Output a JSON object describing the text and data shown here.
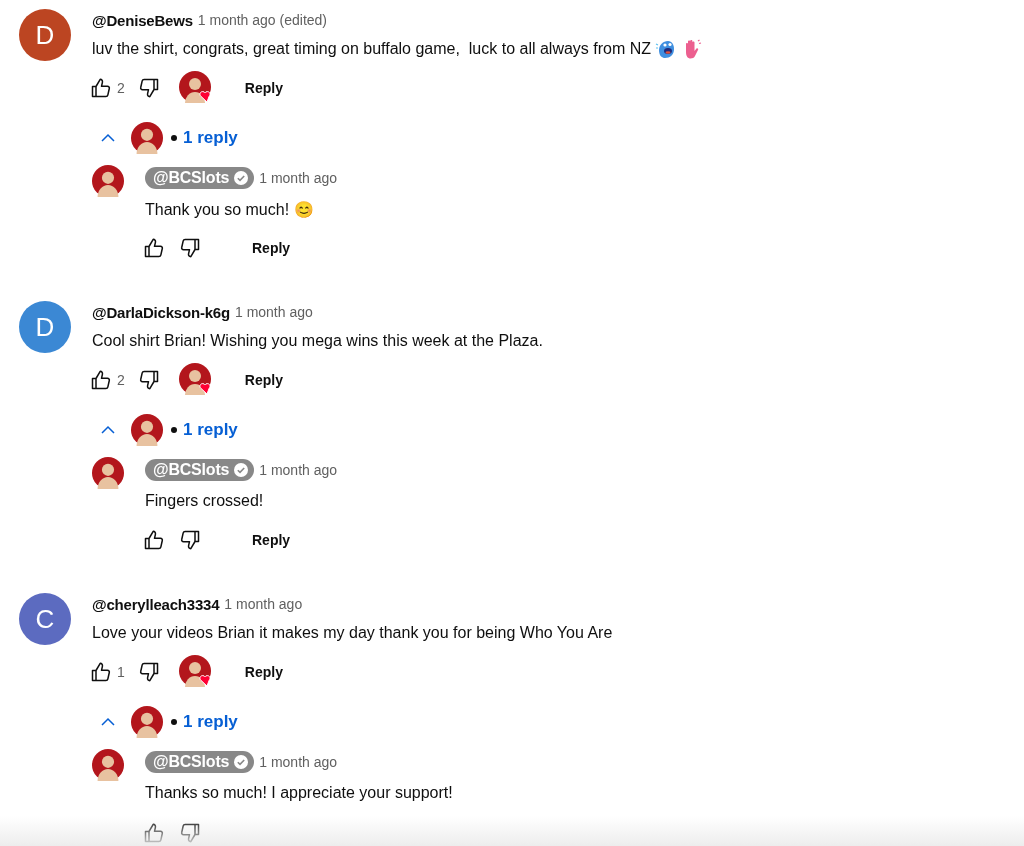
{
  "comments": [
    {
      "author": "@DeniseBews",
      "avatar_letter": "D",
      "color": "#bc4522",
      "time": "1 month ago (edited)",
      "text": "luv the shirt, congrats, great timing on buffalo game,  luck to all always from NZ",
      "emojis": [
        {
          "kind": "blob"
        },
        {
          "kind": "hand"
        }
      ],
      "likes": "2",
      "hearted": true,
      "reply_button": "Reply",
      "replies_toggle": {
        "expanded": true,
        "label": "1 reply"
      },
      "replies": [
        {
          "author": "@BCSlots",
          "creator": true,
          "verified": true,
          "time": "1 month ago",
          "text": "Thank you so much! 😊",
          "reply_button": "Reply",
          "actions_cut": false
        }
      ]
    },
    {
      "author": "@DarlaDickson-k6g",
      "avatar_letter": "D",
      "color": "#3b88d4",
      "time": "1 month ago",
      "text": "Cool shirt Brian! Wishing you mega wins this week at the Plaza.",
      "likes": "2",
      "hearted": true,
      "reply_button": "Reply",
      "replies_toggle": {
        "expanded": true,
        "label": "1 reply"
      },
      "replies": [
        {
          "author": "@BCSlots",
          "creator": true,
          "verified": true,
          "time": "1 month ago",
          "text": "Fingers crossed!",
          "reply_button": "Reply",
          "actions_cut": false
        }
      ]
    },
    {
      "author": "@cherylleach3334",
      "avatar_letter": "C",
      "color": "#5c6bc0",
      "time": "1 month ago",
      "text": "Love your videos Brian it makes my day thank you for being Who You Are",
      "likes": "1",
      "hearted": true,
      "reply_button": "Reply",
      "replies_toggle": {
        "expanded": true,
        "label": "1 reply"
      },
      "replies": [
        {
          "author": "@BCSlots",
          "creator": true,
          "verified": true,
          "time": "1 month ago",
          "text": "Thanks so much! I appreciate your support!",
          "actions_cut": true
        }
      ]
    }
  ]
}
